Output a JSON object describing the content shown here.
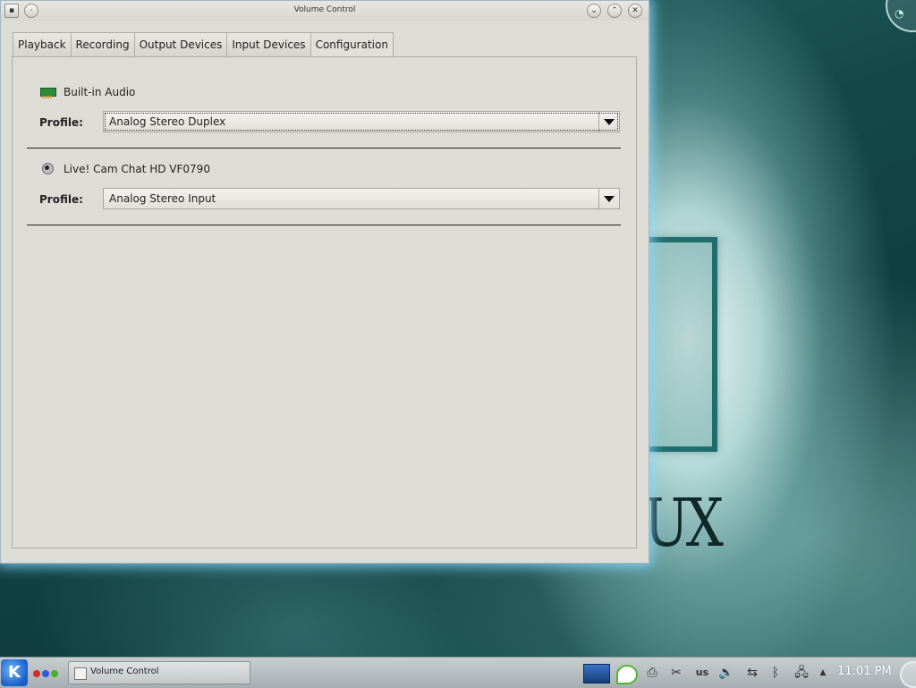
{
  "window": {
    "title": "Volume Control",
    "tabs": [
      {
        "label": "Playback"
      },
      {
        "label": "Recording"
      },
      {
        "label": "Output Devices"
      },
      {
        "label": "Input Devices"
      },
      {
        "label": "Configuration",
        "selected": true
      }
    ],
    "cards": [
      {
        "name": "Built-in Audio",
        "icon": "audio-card-icon",
        "profile_label": "Profile:",
        "profile_value": "Analog Stereo Duplex"
      },
      {
        "name": "Live! Cam Chat HD VF0790",
        "icon": "webcam-icon",
        "profile_label": "Profile:",
        "profile_value": "Analog Stereo Input"
      }
    ]
  },
  "desktop": {
    "wallpaper_text": "UX"
  },
  "taskbar": {
    "task_label": "Volume Control",
    "keyboard_layout": "us",
    "clock": "11:01 PM"
  },
  "colors": {
    "window_bg": "#dedcd6",
    "window_glow": "#8cdcff",
    "wallpaper": "#14494b",
    "kmenu": "#1d5fc9"
  }
}
